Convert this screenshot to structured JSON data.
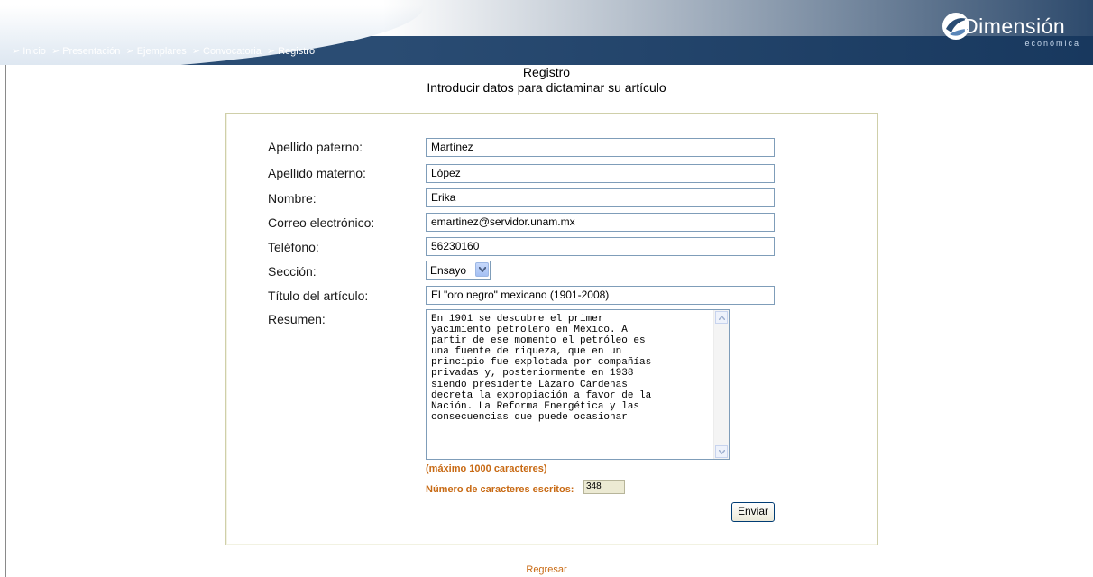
{
  "header": {
    "nav": [
      {
        "label": "Inicio"
      },
      {
        "label": "Presentación"
      },
      {
        "label": "Ejemplares"
      },
      {
        "label": "Convocatoria"
      },
      {
        "label": "Registro"
      }
    ],
    "separator": "➢",
    "brand_name": "Dimensión",
    "brand_sub": "económica"
  },
  "page": {
    "title": "Registro",
    "subtitle": "Introducir datos para dictaminar su artículo"
  },
  "form": {
    "apellido_paterno": {
      "label": "Apellido paterno:",
      "value": "Martínez"
    },
    "apellido_materno": {
      "label": "Apellido materno:",
      "value": "López"
    },
    "nombre": {
      "label": "Nombre:",
      "value": "Erika"
    },
    "correo": {
      "label": "Correo electrónico:",
      "value": "emartinez@servidor.unam.mx"
    },
    "telefono": {
      "label": "Teléfono:",
      "value": "56230160"
    },
    "seccion": {
      "label": "Sección:",
      "value": "Ensayo"
    },
    "titulo": {
      "label": "Título del artículo:",
      "value": "El \"oro negro\" mexicano (1901-2008)"
    },
    "resumen": {
      "label": "Resumen:",
      "value": "En 1901 se descubre el primer\nyacimiento petrolero en México. A\npartir de ese momento el petróleo es\nuna fuente de riqueza, que en un\nprincipio fue explotada por compañías\nprivadas y, posteriormente en 1938\nsiendo presidente Lázaro Cárdenas\ndecreta la expropiación a favor de la\nNación. La Reforma Energética y las\nconsecuencias que puede ocasionar"
    },
    "max_note": "(máximo 1000 caracteres)",
    "count_label": "Número de caracteres escritos:",
    "count_value": "348",
    "submit_label": "Enviar"
  },
  "footer": {
    "back_label": "Regresar"
  },
  "colors": {
    "header_blue": "#2a4c73",
    "accent_orange": "#c86a14",
    "input_border": "#7f9db9"
  },
  "icons": {
    "nav_separator": "arrow-right-icon",
    "brand_logo": "dimension-logo-icon",
    "select_toggle": "chevron-down-icon"
  }
}
